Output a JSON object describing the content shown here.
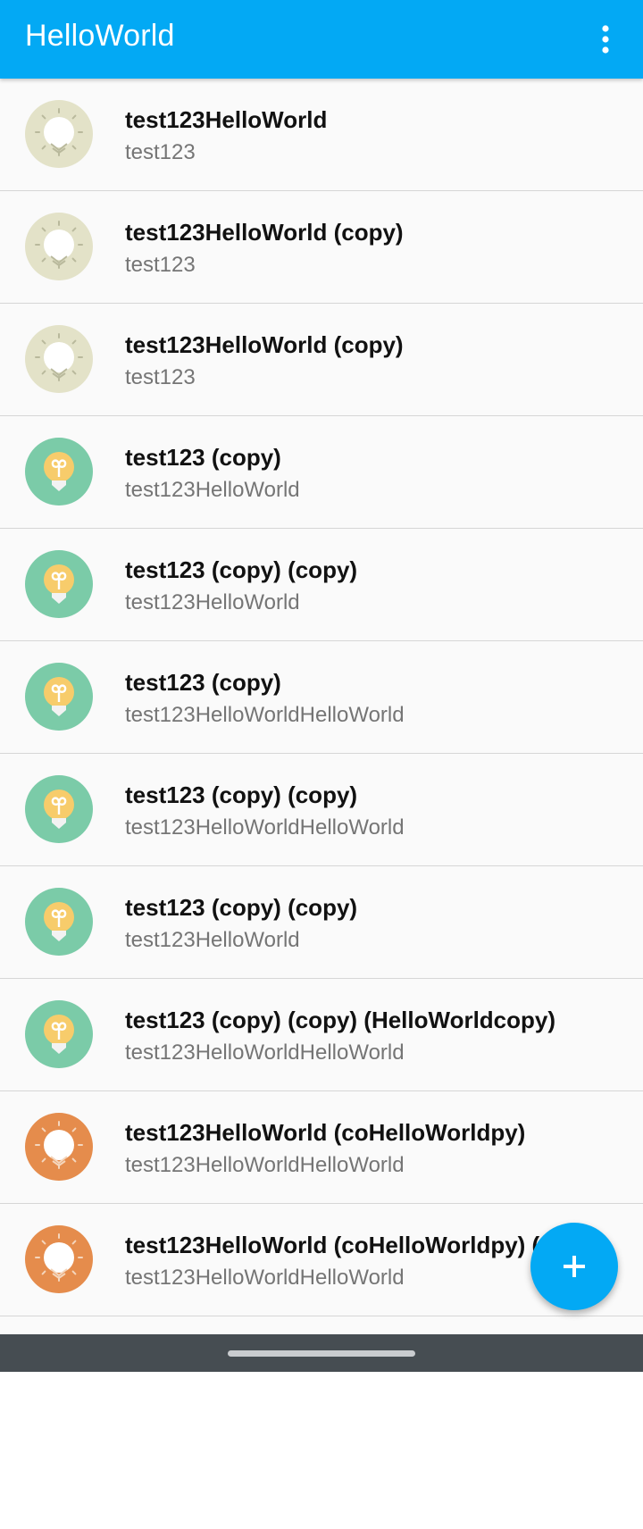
{
  "app": {
    "title": "HelloWorld"
  },
  "colors": {
    "primary": "#03a9f4",
    "avatar_beige": "#e3e2c8",
    "avatar_green": "#7bcba8",
    "avatar_orange": "#e58c4c",
    "bulb_yellow": "#f7cc6b"
  },
  "icons": {
    "overflow": "more-vertical-icon",
    "fab": "plus-icon"
  },
  "items": [
    {
      "title": "test123HelloWorld",
      "subtitle": "test123",
      "icon": "beige"
    },
    {
      "title": "test123HelloWorld (copy)",
      "subtitle": "test123",
      "icon": "beige"
    },
    {
      "title": "test123HelloWorld (copy)",
      "subtitle": "test123",
      "icon": "beige"
    },
    {
      "title": "test123 (copy)",
      "subtitle": "test123HelloWorld",
      "icon": "green"
    },
    {
      "title": "test123 (copy) (copy)",
      "subtitle": "test123HelloWorld",
      "icon": "green"
    },
    {
      "title": "test123 (copy)",
      "subtitle": "test123HelloWorldHelloWorld",
      "icon": "green"
    },
    {
      "title": "test123 (copy) (copy)",
      "subtitle": "test123HelloWorldHelloWorld",
      "icon": "green"
    },
    {
      "title": "test123 (copy) (copy)",
      "subtitle": "test123HelloWorld",
      "icon": "green"
    },
    {
      "title": "test123 (copy) (copy) (HelloWorldcopy)",
      "subtitle": "test123HelloWorldHelloWorld",
      "icon": "green"
    },
    {
      "title": "test123HelloWorld (coHelloWorldpy)",
      "subtitle": "test123HelloWorldHelloWorld",
      "icon": "orange"
    },
    {
      "title": "test123HelloWorld (coHelloWorldpy) (copy)",
      "subtitle": "test123HelloWorldHelloWorld",
      "icon": "orange"
    }
  ]
}
